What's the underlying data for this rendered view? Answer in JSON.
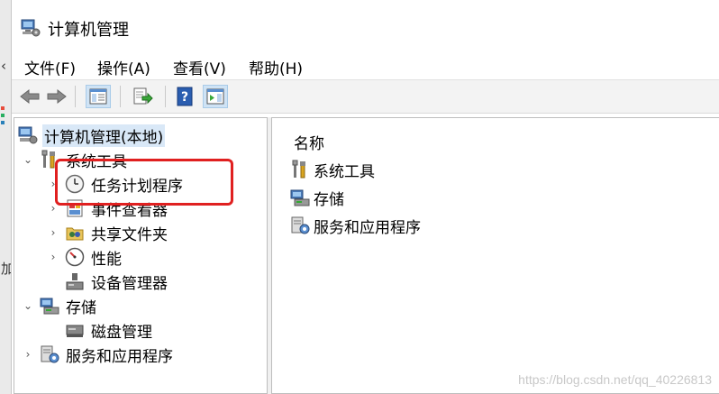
{
  "window": {
    "title": "计算机管理"
  },
  "background_window": {
    "glyph_arrow": "‹",
    "glyph_text": "加"
  },
  "menubar": {
    "items": [
      "文件(F)",
      "操作(A)",
      "查看(V)",
      "帮助(H)"
    ]
  },
  "tree": {
    "root": "计算机管理(本地)",
    "system_tools": "系统工具",
    "task_scheduler": "任务计划程序",
    "event_viewer": "事件查看器",
    "shared_folders": "共享文件夹",
    "performance": "性能",
    "device_manager": "设备管理器",
    "storage": "存储",
    "disk_management": "磁盘管理",
    "services_apps": "服务和应用程序"
  },
  "list": {
    "header": "名称",
    "rows": [
      "系统工具",
      "存储",
      "服务和应用程序"
    ]
  },
  "toolbar": {
    "icons": [
      "back-arrow-icon",
      "forward-arrow-icon",
      "show-hide-console-tree-icon",
      "export-list-icon",
      "help-icon",
      "action-pane-icon"
    ]
  },
  "watermark": "https://blog.csdn.net/qq_40226813",
  "colors": {
    "highlight": "#e02020",
    "selection": "#d9e8f7",
    "toolbar_active": "#cfe3f5"
  }
}
